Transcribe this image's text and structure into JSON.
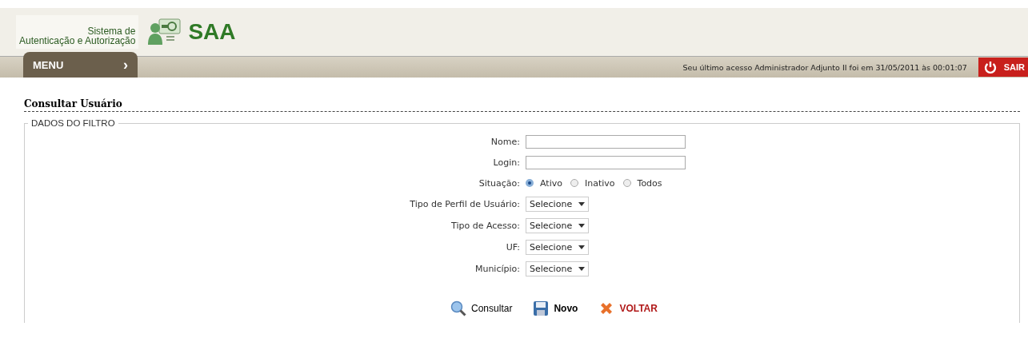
{
  "header": {
    "system_name_line1": "Sistema de",
    "system_name_line2": "Autenticação e Autorização",
    "logo_text": "SAA"
  },
  "menu_bar": {
    "menu_label": "MENU",
    "menu_arrow": "›",
    "last_access": "Seu último acesso Administrador Adjunto II foi em 31/05/2011 às 00:01:07",
    "logout_label": "SAIR"
  },
  "page_title": "Consultar Usuário",
  "filter": {
    "legend": "DADOS DO FILTRO",
    "fields": [
      {
        "kind": "text",
        "label": "Nome:"
      },
      {
        "kind": "text",
        "label": "Login:"
      },
      {
        "kind": "radio",
        "label": "Situação:",
        "options": [
          {
            "label": "Ativo",
            "selected": true
          },
          {
            "label": "Inativo",
            "selected": false
          },
          {
            "label": "Todos",
            "selected": false
          }
        ]
      },
      {
        "kind": "select",
        "label": "Tipo de Perfil de Usuário:",
        "value": "Selecione"
      },
      {
        "kind": "select",
        "label": "Tipo de Acesso:",
        "value": "Selecione"
      },
      {
        "kind": "select",
        "label": "UF:",
        "value": "Selecione"
      },
      {
        "kind": "select",
        "label": "Município:",
        "value": "Selecione"
      }
    ]
  },
  "actions": [
    {
      "kind": "search",
      "label": "Consultar"
    },
    {
      "kind": "save",
      "label": "Novo"
    },
    {
      "kind": "back",
      "label": "VOLTAR"
    }
  ]
}
